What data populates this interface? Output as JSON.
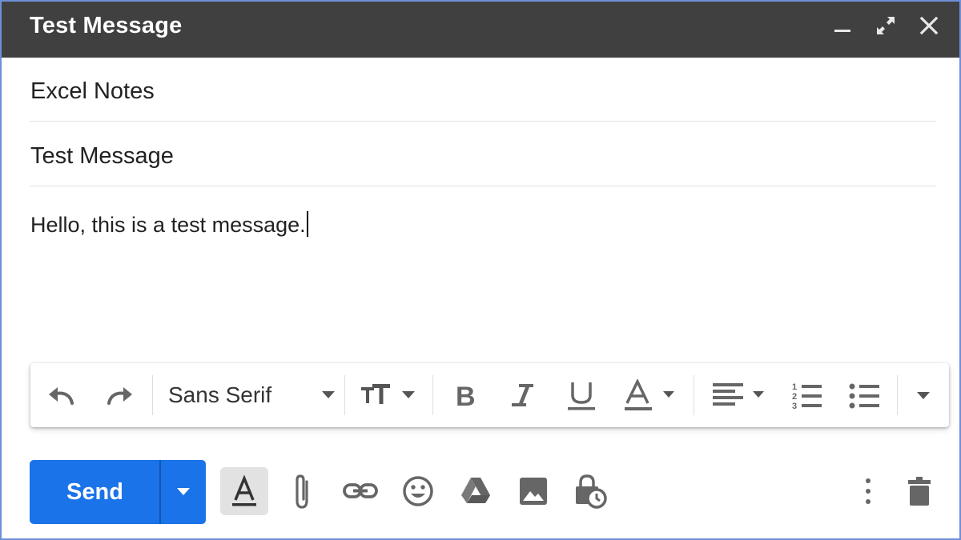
{
  "window": {
    "title": "Test Message",
    "controls": [
      "minimize-icon",
      "expand-icon",
      "close-icon"
    ]
  },
  "fields": {
    "to": "Excel Notes",
    "subject": "Test Message"
  },
  "body": {
    "text": "Hello, this is a test message."
  },
  "format_toolbar": {
    "font": "Sans Serif",
    "icons": [
      "undo-icon",
      "redo-icon",
      "font-size-icon",
      "bold-icon",
      "italic-icon",
      "underline-icon",
      "text-color-icon",
      "align-icon",
      "numbered-list-icon",
      "bulleted-list-icon",
      "more-formatting-icon"
    ]
  },
  "bottom_toolbar": {
    "send_label": "Send",
    "icons": [
      "formatting-options-icon",
      "attach-icon",
      "link-icon",
      "emoji-icon",
      "drive-icon",
      "photo-icon",
      "confidential-icon",
      "more-options-icon",
      "discard-icon"
    ]
  },
  "colors": {
    "titlebar": "#404040",
    "send_button": "#1a73e8",
    "icon_gray": "#5f6368",
    "window_border": "#6e8fd8"
  }
}
